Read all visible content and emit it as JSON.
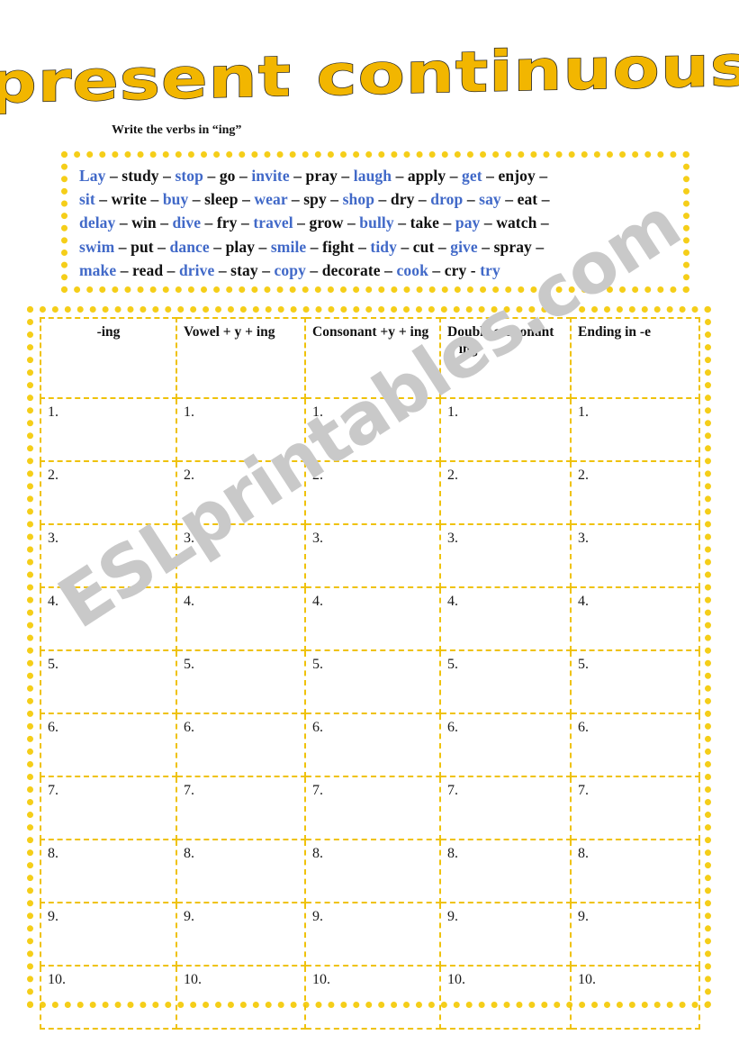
{
  "page": {
    "background_color": "#ffffff",
    "accent_color": "#F5CE19",
    "title_fill_color": "#F2B600",
    "blue_word_color": "#4169C8",
    "black_word_color": "#111111",
    "watermark_color": "#c9c9c9"
  },
  "header": {
    "title": "present continuous",
    "instruction": "Write the verbs in “ing”"
  },
  "watermark": {
    "text": "ESLprintables.com"
  },
  "word_bank": {
    "lines": [
      [
        {
          "word": "Lay",
          "color": "blue",
          "sep": "–"
        },
        {
          "word": "study",
          "color": "black",
          "sep": "–"
        },
        {
          "word": "stop",
          "color": "blue",
          "sep": "–"
        },
        {
          "word": "go",
          "color": "black",
          "sep": "–"
        },
        {
          "word": "invite",
          "color": "blue",
          "sep": "–"
        },
        {
          "word": "pray",
          "color": "black",
          "sep": "–"
        },
        {
          "word": "laugh",
          "color": "blue",
          "sep": "–"
        },
        {
          "word": "apply",
          "color": "black",
          "sep": "–"
        },
        {
          "word": "get",
          "color": "blue",
          "sep": "–"
        },
        {
          "word": "enjoy",
          "color": "black",
          "sep": "–"
        }
      ],
      [
        {
          "word": "sit",
          "color": "blue",
          "sep": "–"
        },
        {
          "word": "write",
          "color": "black",
          "sep": "–"
        },
        {
          "word": "buy",
          "color": "blue",
          "sep": "–"
        },
        {
          "word": "sleep",
          "color": "black",
          "sep": "–"
        },
        {
          "word": "wear",
          "color": "blue",
          "sep": "–"
        },
        {
          "word": "spy",
          "color": "black",
          "sep": "–"
        },
        {
          "word": "shop",
          "color": "blue",
          "sep": "–"
        },
        {
          "word": "dry",
          "color": "black",
          "sep": "–"
        },
        {
          "word": "drop",
          "color": "blue",
          "sep": "–"
        },
        {
          "word": "say",
          "color": "blue",
          "sep": "–"
        },
        {
          "word": "eat",
          "color": "black",
          "sep": "–"
        }
      ],
      [
        {
          "word": "delay",
          "color": "blue",
          "sep": "–"
        },
        {
          "word": "win",
          "color": "black",
          "sep": "–"
        },
        {
          "word": "dive",
          "color": "blue",
          "sep": "–"
        },
        {
          "word": "fry",
          "color": "black",
          "sep": "–"
        },
        {
          "word": "travel",
          "color": "blue",
          "sep": "–"
        },
        {
          "word": "grow",
          "color": "black",
          "sep": "–"
        },
        {
          "word": "bully",
          "color": "blue",
          "sep": "–"
        },
        {
          "word": "take",
          "color": "black",
          "sep": "–"
        },
        {
          "word": "pay",
          "color": "blue",
          "sep": "–"
        },
        {
          "word": "watch",
          "color": "black",
          "sep": "–"
        }
      ],
      [
        {
          "word": "swim",
          "color": "blue",
          "sep": "–"
        },
        {
          "word": "put",
          "color": "black",
          "sep": "–"
        },
        {
          "word": "dance",
          "color": "blue",
          "sep": "–"
        },
        {
          "word": "play",
          "color": "black",
          "sep": "–"
        },
        {
          "word": "smile",
          "color": "blue",
          "sep": "–"
        },
        {
          "word": "fight",
          "color": "black",
          "sep": "–"
        },
        {
          "word": "tidy",
          "color": "blue",
          "sep": "–"
        },
        {
          "word": "cut",
          "color": "black",
          "sep": "–"
        },
        {
          "word": "give",
          "color": "blue",
          "sep": "–"
        },
        {
          "word": "spray",
          "color": "black",
          "sep": "–"
        }
      ],
      [
        {
          "word": "make",
          "color": "blue",
          "sep": "–"
        },
        {
          "word": "read",
          "color": "black",
          "sep": "–"
        },
        {
          "word": "drive",
          "color": "blue",
          "sep": "–"
        },
        {
          "word": "stay",
          "color": "black",
          "sep": "–"
        },
        {
          "word": "copy",
          "color": "blue",
          "sep": "–"
        },
        {
          "word": "decorate",
          "color": "black",
          "sep": "–"
        },
        {
          "word": "cook",
          "color": "blue",
          "sep": "–"
        },
        {
          "word": "cry",
          "color": "black",
          "sep": "-"
        },
        {
          "word": "try",
          "color": "blue",
          "sep": ""
        }
      ]
    ]
  },
  "table": {
    "headers": [
      "-ing",
      "Vowel + y + ing",
      "Consonant +y  + ing",
      "Double consonant + ing",
      "Ending in -e"
    ],
    "row_labels": [
      "1.",
      "2.",
      "3.",
      "4.",
      "5.",
      "6.",
      "7.",
      "8.",
      "9.",
      "10."
    ],
    "rows": [
      [
        "1.",
        "1.",
        "1.",
        "1.",
        "1."
      ],
      [
        "2.",
        "2.",
        "2.",
        "2.",
        "2."
      ],
      [
        "3.",
        "3.",
        "3.",
        "3.",
        "3."
      ],
      [
        "4.",
        "4.",
        "4.",
        "4.",
        "4."
      ],
      [
        "5.",
        "5.",
        "5.",
        "5.",
        "5."
      ],
      [
        "6.",
        "6.",
        "6.",
        "6.",
        "6."
      ],
      [
        "7.",
        "7.",
        "7.",
        "7.",
        "7."
      ],
      [
        "8.",
        "8.",
        "8.",
        "8.",
        "8."
      ],
      [
        "9.",
        "9.",
        "9.",
        "9.",
        "9."
      ],
      [
        "10.",
        "10.",
        "10.",
        "10.",
        "10."
      ]
    ]
  }
}
